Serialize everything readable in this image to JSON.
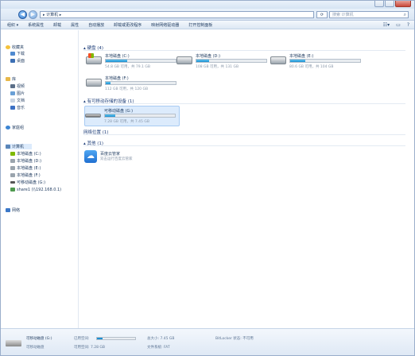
{
  "address": {
    "path": "▸ 计算机 ▸",
    "search_placeholder": "搜索 计算机"
  },
  "commands": [
    "组织 ▾",
    "系统属性",
    "卸载",
    "属性",
    "自动播放",
    "卸载或更改程序",
    "映射网络驱动器",
    "打开控制面板"
  ],
  "nav": {
    "favorites": "收藏夹",
    "fav_items": [
      "下载",
      "桌面"
    ],
    "libraries": "库",
    "lib_items": [
      "视频",
      "图片",
      "文档",
      "音乐"
    ],
    "homegroup": "家庭组",
    "computer": "计算机",
    "comp_items": [
      "本地磁盘 (C:)",
      "本地磁盘 (D:)",
      "本地磁盘 (E:)",
      "本地磁盘 (F:)",
      "可移动磁盘 (G:)",
      "share1 (\\\\192.168.0.1)"
    ],
    "network": "网络"
  },
  "groups": {
    "hard_disks": "▴ 硬盘 (4)",
    "removable": "▴ 有可移动存储的设备 (1)",
    "network_location": "网络位置 (1)",
    "other": "▴ 其他 (1)"
  },
  "drives": [
    {
      "name": "本地磁盘 (C:)",
      "free": "54.8 GB 可用，共 79.1 GB",
      "used_fraction": 0.31
    },
    {
      "name": "本地磁盘 (D:)",
      "free": "108 GB 可用，共 131 GB",
      "used_fraction": 0.18
    },
    {
      "name": "本地磁盘 (E:)",
      "free": "80.6 GB 可用，共 104 GB",
      "used_fraction": 0.22
    },
    {
      "name": "本地磁盘 (F:)",
      "free": "112 GB 可用，共 120 GB",
      "used_fraction": 0.07
    }
  ],
  "removable_drive": {
    "name": "可移动磁盘 (G:)",
    "free": "7.28 GB 可用，共 7.45 GB",
    "used_fraction": 0.15
  },
  "app": {
    "name": "百度云管家",
    "sub": "双击运行百度云管家"
  },
  "details": {
    "name": "可移动磁盘 (G:)",
    "type": "可移动磁盘",
    "used_label": "已用空间:",
    "free_label": "可用空间: 7.28 GB",
    "total_label": "总大小: 7.45 GB",
    "fs_label": "文件系统: FAT",
    "bitlocker_label": "BitLocker 状态: 不可用",
    "used_fraction": 0.15
  },
  "colors": {
    "accent": "#1d8fd1",
    "window_bg": "#ffffff",
    "chrome": "#dfe8f3"
  }
}
